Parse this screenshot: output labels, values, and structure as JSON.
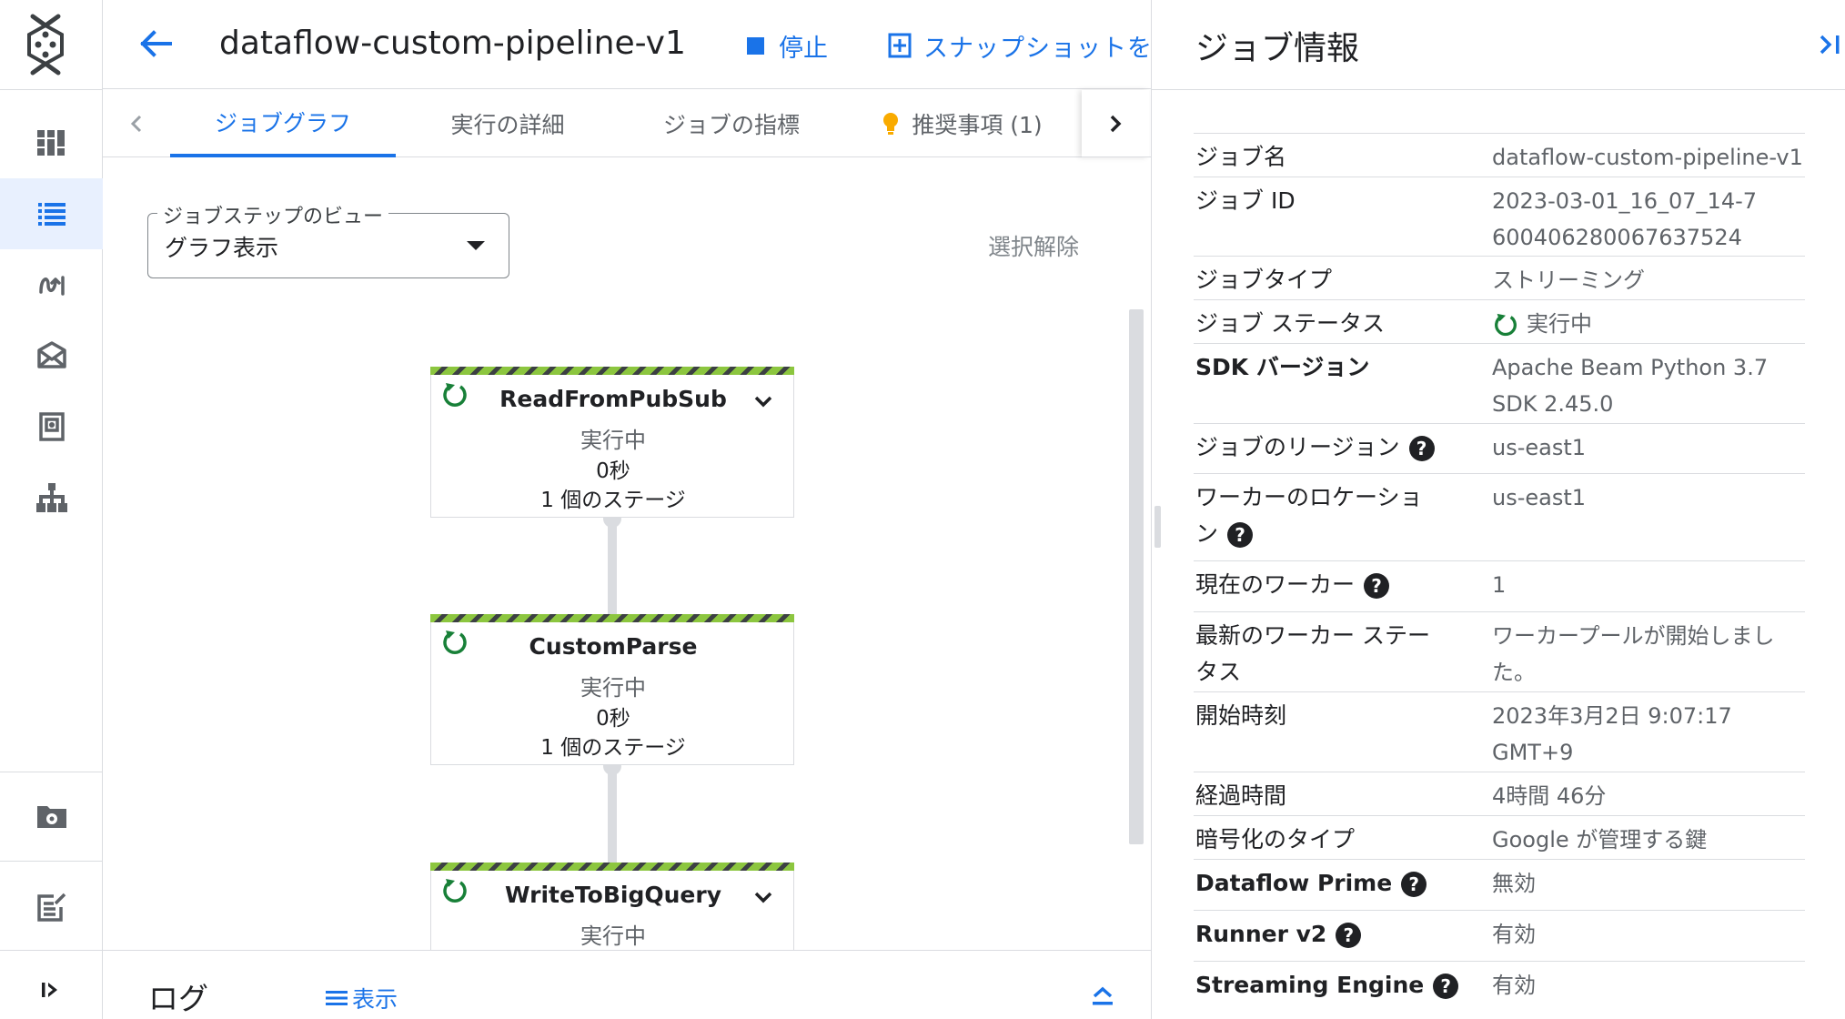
{
  "header": {
    "job_title": "dataflow-custom-pipeline-v1",
    "stop_label": "停止",
    "snapshot_label": "スナップショットを作成"
  },
  "tabs": [
    {
      "label": "ジョブグラフ",
      "active": true
    },
    {
      "label": "実行の詳細",
      "active": false
    },
    {
      "label": "ジョブの指標",
      "active": false
    },
    {
      "label": "推奨事項 (1)",
      "active": false
    }
  ],
  "view_select": {
    "label": "ジョブステップのビュー",
    "value": "グラフ表示"
  },
  "deselect_label": "選択解除",
  "nodes": [
    {
      "name": "ReadFromPubSub",
      "status": "実行中",
      "time": "0秒",
      "stages": "1 個のステージ",
      "expandable": true
    },
    {
      "name": "CustomParse",
      "status": "実行中",
      "time": "0秒",
      "stages": "1 個のステージ",
      "expandable": false
    },
    {
      "name": "WriteToBigQuery",
      "status": "実行中",
      "time": "",
      "stages": "",
      "expandable": true
    }
  ],
  "log": {
    "title": "ログ",
    "show_label": "表示"
  },
  "panel": {
    "title": "ジョブ情報",
    "rows": [
      {
        "label": "ジョブ名",
        "value": "dataflow-custom-pipeline-v1"
      },
      {
        "label": "ジョブ ID",
        "value": "2023-03-01_16_07_14-7600406280067637524"
      },
      {
        "label": "ジョブタイプ",
        "value": "ストリーミング"
      },
      {
        "label": "ジョブ ステータス",
        "value": "実行中"
      },
      {
        "label": "SDK バージョン",
        "value": "Apache Beam Python 3.7 SDK 2.45.0"
      },
      {
        "label": "ジョブのリージョン",
        "value": "us-east1"
      },
      {
        "label": "ワーカーのロケーション",
        "value": "us-east1"
      },
      {
        "label": "現在のワーカー",
        "value": "1"
      },
      {
        "label": "最新のワーカー ステータス",
        "value": "ワーカープールが開始しました。"
      },
      {
        "label": "開始時刻",
        "value": "2023年3月2日 9:07:17 GMT+9"
      },
      {
        "label": "経過時間",
        "value": "4時間 46分"
      },
      {
        "label": "暗号化のタイプ",
        "value": "Google が管理する鍵"
      },
      {
        "label": "Dataflow Prime",
        "value": "無効"
      },
      {
        "label": "Runner v2",
        "value": "有効"
      },
      {
        "label": "Streaming Engine",
        "value": "有効"
      }
    ]
  },
  "colors": {
    "accent": "#1a73e8",
    "running": "#188038",
    "stripe_green": "#8cc63f"
  },
  "icons": [
    "dataflow-logo-icon",
    "dashboard-icon",
    "jobs-list-icon",
    "pipelines-icon",
    "notebooks-icon",
    "snapshots-icon",
    "sql-workspace-icon",
    "settings-folder-icon",
    "release-notes-icon",
    "expand-rail-icon"
  ]
}
